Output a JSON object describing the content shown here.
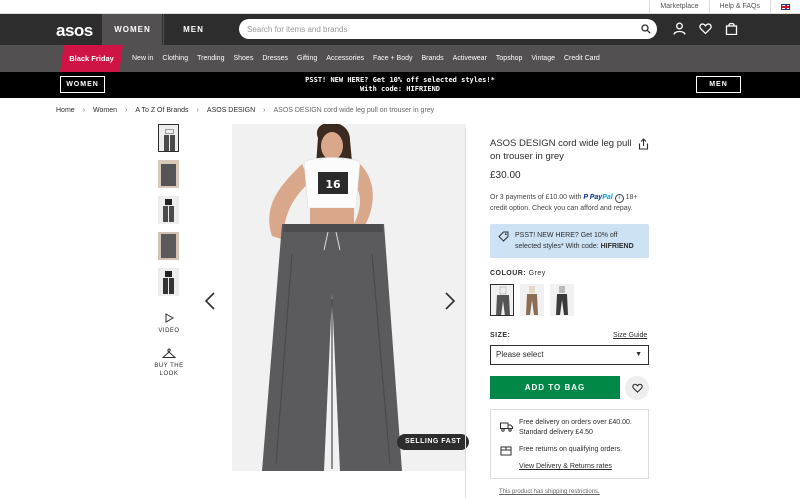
{
  "utility": {
    "marketplace": "Marketplace",
    "help": "Help & FAQs"
  },
  "header": {
    "logo": "asos",
    "tab_women": "WOMEN",
    "tab_men": "MEN",
    "search_placeholder": "Search for items and brands"
  },
  "catnav": {
    "black_friday": "Black Friday",
    "items": [
      "New in",
      "Clothing",
      "Trending",
      "Shoes",
      "Dresses",
      "Gifting",
      "Accessories",
      "Face + Body",
      "Brands",
      "Activewear",
      "Topshop",
      "Vintage",
      "Credit Card"
    ]
  },
  "promo": {
    "women": "WOMEN",
    "men": "MEN",
    "line1": "PSST! NEW HERE? Get 10% off selected styles!*",
    "line2": "With code: HIFRIEND"
  },
  "breadcrumb": {
    "items": [
      "Home",
      "Women",
      "A To Z Of Brands",
      "ASOS DESIGN"
    ],
    "current": "ASOS DESIGN cord wide leg pull on trouser in grey"
  },
  "gallery": {
    "video_label": "VIDEO",
    "btl_label1": "BUY THE",
    "btl_label2": "LOOK",
    "badge": "SELLING FAST"
  },
  "product": {
    "title": "ASOS DESIGN cord wide leg pull on trouser in grey",
    "price": "£30.00",
    "klarna_pre": "Or 3 payments of £10.00 with",
    "paypal_a": "Pay",
    "paypal_b": "Pal",
    "klarna_post": "18+ credit option. Check you can afford and repay.",
    "promo_line1": "PSST! NEW HERE? Get 10% off",
    "promo_line2": "selected styles* With code:",
    "promo_code": "HIFRIEND",
    "colour_label": "COLOUR:",
    "colour_value": "Grey",
    "size_label": "SIZE:",
    "size_guide": "Size Guide",
    "size_placeholder": "Please select",
    "add_to_bag": "ADD TO BAG",
    "delivery_line1": "Free delivery on orders over £40.00.",
    "delivery_line2": "Standard delivery £4.50",
    "returns": "Free returns on qualifying orders.",
    "delivery_link": "View Delivery & Returns rates",
    "shipping_restrictions": "This product has shipping restrictions."
  },
  "colors": {
    "dark": "#2d2d2d",
    "nav": "#525050",
    "black_friday": "#d01345",
    "add_to_bag": "#018849",
    "promo_box": "#cde2f5"
  }
}
